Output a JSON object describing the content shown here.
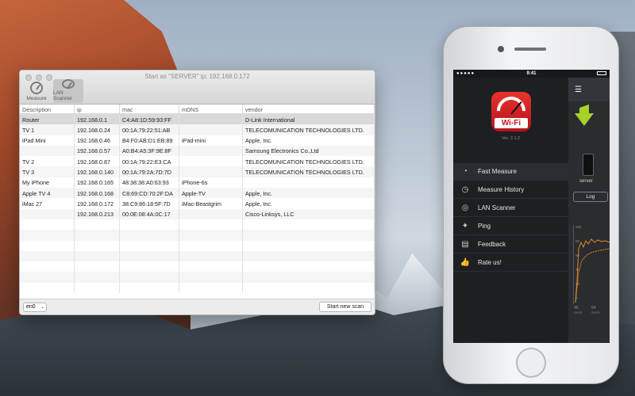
{
  "window": {
    "title": "Start as \"SERVER\" ip: 192.168.0.172",
    "tools": [
      {
        "label": "Measure"
      },
      {
        "label": "LAN Scanner"
      }
    ]
  },
  "table": {
    "columns": [
      "Description",
      "ip",
      "mac",
      "mDNS",
      "vendor"
    ],
    "rows": [
      [
        "Router",
        "192.168.0.1",
        "C4:A8:1D:59:93:FF",
        "",
        "D-Link International"
      ],
      [
        "TV 1",
        "192.168.0.24",
        "00:1A:79:22:51:AB",
        "",
        "TELECOMUNICATION TECHNOLOGIES LTD."
      ],
      [
        "iPad Mini",
        "192.168.0.46",
        "B4:F0:AB:D1:EB:89",
        "iPad-mini",
        "Apple, Inc."
      ],
      [
        "",
        "192.168.0.57",
        "A0:B4:A5:3F:9E:8F",
        "",
        "Samsung Electronics Co.,Ltd"
      ],
      [
        "TV 2",
        "192.168.0.87",
        "00:1A:79:22:E3:CA",
        "",
        "TELECOMUNICATION TECHNOLOGIES LTD."
      ],
      [
        "TV 3",
        "192.168.0.140",
        "00:1A:79:2A:7D:7D",
        "",
        "TELECOMUNICATION TECHNOLOGIES LTD."
      ],
      [
        "My iPhone",
        "192.168.0.165",
        "48:38:38:A0:63:93",
        "iPhone-6s",
        ""
      ],
      [
        "Apple TV 4",
        "192.168.0.168",
        "C8:69:CD:70:2F:DA",
        "Apple-TV",
        "Apple, Inc."
      ],
      [
        "iMac 27",
        "192.168.0.172",
        "38:C9:86:18:5F:7D",
        "iMac-Beastgrim",
        "Apple, Inc."
      ],
      [
        "",
        "192.168.0.213",
        "00:0E:08:4A:0C:17",
        "",
        "Cisco-Linksys, LLC"
      ],
      [
        "",
        "",
        "",
        "",
        ""
      ],
      [
        "",
        "",
        "",
        "",
        ""
      ],
      [
        "",
        "",
        "",
        "",
        ""
      ],
      [
        "",
        "",
        "",
        "",
        ""
      ],
      [
        "",
        "",
        "",
        "",
        ""
      ],
      [
        "",
        "",
        "",
        "",
        ""
      ],
      [
        "",
        "",
        "",
        "",
        ""
      ]
    ],
    "selected_row": 0
  },
  "footer": {
    "interface": "en0",
    "scan_button": "Start new scan"
  },
  "phone": {
    "time": "9:41",
    "logo_text": "Wi-Fi",
    "version": "Ver. 2.1.2",
    "menu": [
      {
        "label": "Fast Measure",
        "icon": "gauge-icon",
        "glyph": "◔"
      },
      {
        "label": "Measure History",
        "icon": "history-icon",
        "glyph": "◷"
      },
      {
        "label": "LAN Scanner",
        "icon": "scanner-icon",
        "glyph": "◎"
      },
      {
        "label": "Ping",
        "icon": "ping-icon",
        "glyph": "✦"
      },
      {
        "label": "Feedback",
        "icon": "feedback-icon",
        "glyph": "▤"
      },
      {
        "label": "Rate us!",
        "icon": "thumbs-up-icon",
        "glyph": "👍"
      }
    ],
    "active_menu": 0,
    "server_label": "server",
    "log_button": "Log",
    "chart": {
      "yticks": [
        "100",
        "80",
        "60",
        "40",
        "20",
        "0"
      ],
      "xticks": [
        {
          "val": "45",
          "time": "23:03"
        },
        {
          "val": "54",
          "time": "23:03"
        }
      ]
    }
  }
}
